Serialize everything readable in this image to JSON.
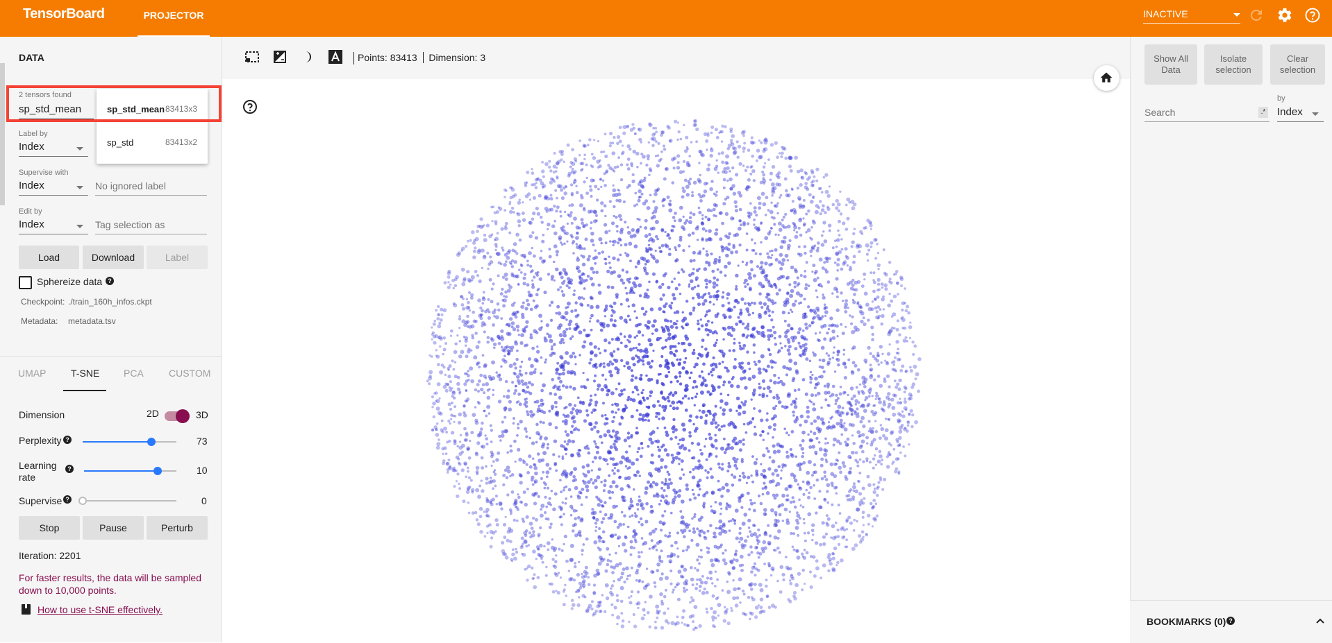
{
  "header": {
    "brand": "TensorBoard",
    "tab": "PROJECTOR",
    "run_status": "INACTIVE",
    "icons": [
      "refresh-icon",
      "settings-icon",
      "help-icon"
    ]
  },
  "data_panel": {
    "title": "DATA",
    "tensors_found": "2 tensors found",
    "tensor_value": "sp_std_mean",
    "tensor_options": [
      {
        "name": "sp_std_mean",
        "shape": "83413x3",
        "selected": true
      },
      {
        "name": "sp_std",
        "shape": "83413x2",
        "selected": false
      }
    ],
    "label_by": {
      "label": "Label by",
      "value": "Index"
    },
    "supervise_with": {
      "label": "Supervise with",
      "value": "Index",
      "ignored_placeholder": "No ignored label"
    },
    "edit_by": {
      "label": "Edit by",
      "value": "Index",
      "tag_placeholder": "Tag selection as"
    },
    "buttons": {
      "load": "Load",
      "download": "Download",
      "label": "Label"
    },
    "sphereize_label": "Sphereize data",
    "sphereize_checked": false,
    "checkpoint_label": "Checkpoint:",
    "checkpoint_value": "./train_160h_infos.ckpt",
    "metadata_label": "Metadata:",
    "metadata_value": "metadata.tsv"
  },
  "projection": {
    "tabs": [
      "UMAP",
      "T-SNE",
      "PCA",
      "CUSTOM"
    ],
    "active_tab": "T-SNE",
    "dimension": {
      "label": "Dimension",
      "off_label": "2D",
      "on_label": "3D",
      "value": "3D"
    },
    "perplexity": {
      "label": "Perplexity",
      "value": "73",
      "fraction": 0.73
    },
    "learning_rate": {
      "label_line1": "Learning",
      "label_line2": "rate",
      "value": "10",
      "fraction": 0.8
    },
    "supervise": {
      "label": "Supervise",
      "value": "0",
      "fraction": 0
    },
    "buttons": {
      "stop": "Stop",
      "pause": "Pause",
      "perturb": "Perturb"
    },
    "iteration": "Iteration: 2201",
    "warning": "For faster results, the data will be sampled down to 10,000 points.",
    "link": "How to use t-SNE effectively."
  },
  "toolbar": {
    "icons": [
      "select-icon",
      "night-mode-icon",
      "contrast-icon",
      "label-icon"
    ],
    "points": "Points: 83413",
    "dimension": "Dimension: 3"
  },
  "inspector": {
    "show_all": "Show All Data",
    "isolate": "Isolate selection",
    "clear": "Clear selection",
    "search_placeholder": "Search",
    "regex_symbol": ".*",
    "by_label": "by",
    "by_value": "Index",
    "bookmarks": "BOOKMARKS (0)"
  },
  "colors": {
    "header": "#f57c00",
    "point": "#3f3fd8",
    "accent": "#880e4f",
    "slider": "#2979ff",
    "highlight": "#f44336"
  }
}
